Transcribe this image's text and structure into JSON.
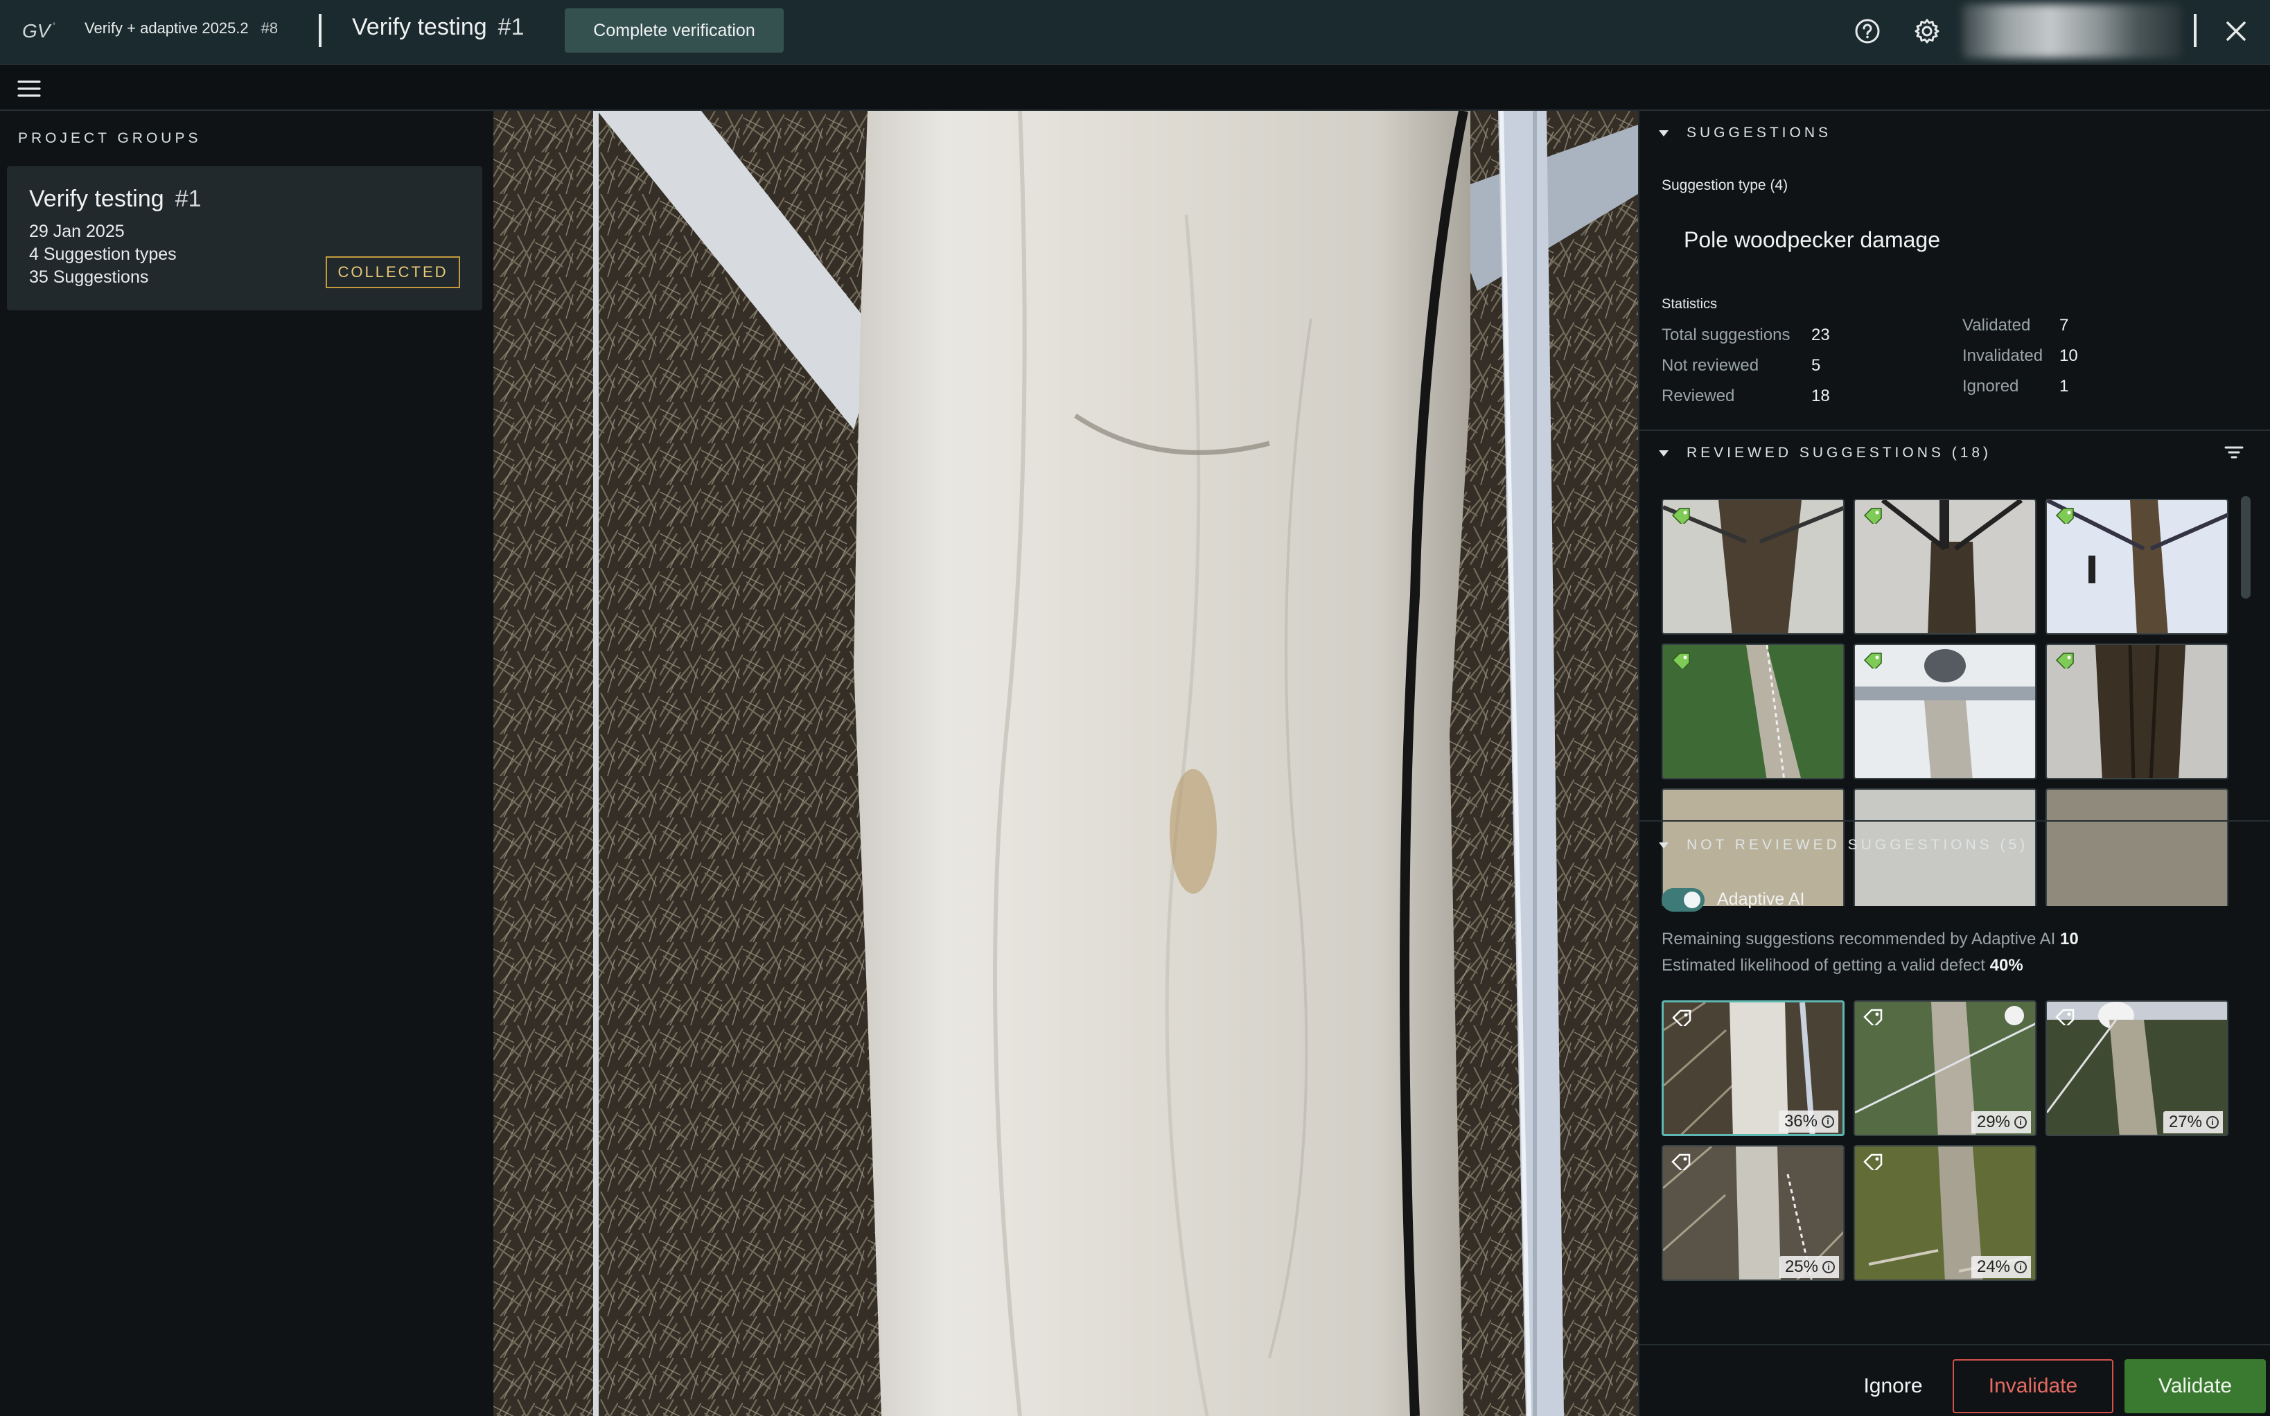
{
  "header": {
    "app_name": "Verify + adaptive 2025.2",
    "app_number": "#8",
    "project_title": "Verify testing",
    "project_number": "#1",
    "complete_button": "Complete verification"
  },
  "icons": {
    "logo": "gv-logo",
    "help": "question-circle-icon",
    "settings": "gear-icon",
    "close": "close-icon",
    "menu": "hamburger-menu-icon",
    "filter": "filter-icon",
    "tag": "tag-icon",
    "info": "info-icon"
  },
  "left_panel": {
    "heading": "PROJECT GROUPS",
    "group": {
      "title": "Verify testing",
      "number": "#1",
      "date": "29 Jan 2025",
      "types": "4 Suggestion types",
      "suggestions": "35 Suggestions",
      "badge": "COLLECTED"
    }
  },
  "suggestions": {
    "heading": "SUGGESTIONS",
    "type_label": "Suggestion type (4)",
    "type_value": "Pole woodpecker damage",
    "statistics_label": "Statistics",
    "stats_left": [
      {
        "label": "Total suggestions",
        "value": "23"
      },
      {
        "label": "Not reviewed",
        "value": "5"
      },
      {
        "label": "Reviewed",
        "value": "18"
      }
    ],
    "stats_right": [
      {
        "label": "Validated",
        "value": "7"
      },
      {
        "label": "Invalidated",
        "value": "10"
      },
      {
        "label": "Ignored",
        "value": "1"
      }
    ]
  },
  "reviewed": {
    "heading": "REVIEWED SUGGESTIONS (18)",
    "thumbnail_count": 6
  },
  "not_reviewed": {
    "heading": "NOT REVIEWED SUGGESTIONS (5)",
    "toggle_label": "Adaptive AI",
    "remaining_text": "Remaining suggestions recommended by Adaptive AI",
    "remaining_value": "10",
    "likelihood_text": "Estimated likelihood of getting a valid defect",
    "likelihood_value": "40%",
    "items": [
      {
        "percent": "36%"
      },
      {
        "percent": "29%"
      },
      {
        "percent": "27%"
      },
      {
        "percent": "25%"
      },
      {
        "percent": "24%"
      }
    ]
  },
  "footer": {
    "ignore": "Ignore",
    "invalidate": "Invalidate",
    "validate": "Validate"
  },
  "colors": {
    "topbar": "#1b2a2e",
    "accent_teal": "#5fb7b3",
    "validated_tag": "#7ecb55",
    "invalidate": "#d3514b",
    "validate": "#3a7a30",
    "collected": "#c59a3d"
  }
}
